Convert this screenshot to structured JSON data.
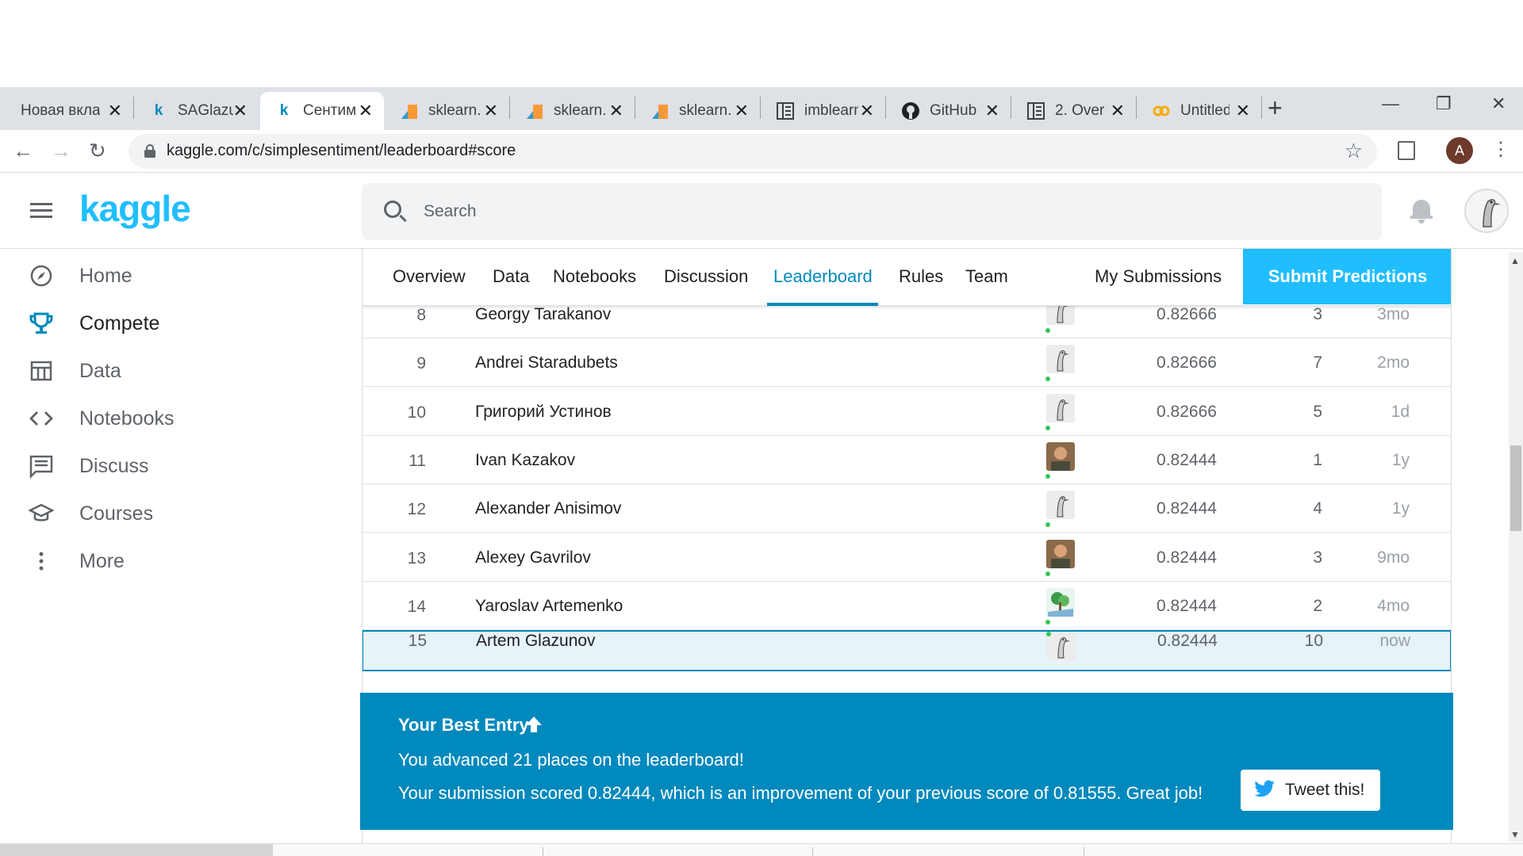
{
  "browser": {
    "tabs": [
      {
        "label": "Новая вкладка",
        "icon": "blank-icon"
      },
      {
        "label": "SAGlazunov",
        "icon": "kaggle-icon"
      },
      {
        "label": "Сентимент",
        "icon": "kaggle-icon",
        "active": true
      },
      {
        "label": "sklearn.",
        "icon": "sklearn-icon"
      },
      {
        "label": "sklearn.",
        "icon": "sklearn-icon"
      },
      {
        "label": "sklearn.",
        "icon": "sklearn-icon"
      },
      {
        "label": "imblearn",
        "icon": "docs-icon"
      },
      {
        "label": "GitHub",
        "icon": "github-icon"
      },
      {
        "label": "2. Over",
        "icon": "docs-icon"
      },
      {
        "label": "Untitled",
        "icon": "colab-icon"
      }
    ],
    "new_tab": "+",
    "window_controls": {
      "minimize": "—",
      "restore": "❐",
      "close": "✕"
    },
    "url": "kaggle.com/c/simplesentiment/leaderboard#score",
    "profile_initial": "A"
  },
  "header": {
    "logo": "kaggle",
    "search_placeholder": "Search"
  },
  "sidebar": {
    "items": [
      {
        "label": "Home",
        "icon": "compass-icon"
      },
      {
        "label": "Compete",
        "icon": "trophy-icon",
        "active": true
      },
      {
        "label": "Data",
        "icon": "table-icon"
      },
      {
        "label": "Notebooks",
        "icon": "code-icon"
      },
      {
        "label": "Discuss",
        "icon": "comment-icon"
      },
      {
        "label": "Courses",
        "icon": "graduation-cap-icon"
      },
      {
        "label": "More",
        "icon": "more-vert-icon"
      }
    ]
  },
  "competition": {
    "tabs": [
      "Overview",
      "Data",
      "Notebooks",
      "Discussion",
      "Leaderboard",
      "Rules",
      "Team",
      "My Submissions"
    ],
    "active_tab": "Leaderboard",
    "submit_label": "Submit Predictions"
  },
  "leaderboard": {
    "rows": [
      {
        "rank": "8",
        "name": "Georgy Tarakanov",
        "score": "0.82666",
        "entries": "3",
        "last": "3mo",
        "avatar": "goose"
      },
      {
        "rank": "9",
        "name": "Andrei Staradubets",
        "score": "0.82666",
        "entries": "7",
        "last": "2mo",
        "avatar": "goose"
      },
      {
        "rank": "10",
        "name": "Григорий Устинов",
        "score": "0.82666",
        "entries": "5",
        "last": "1d",
        "avatar": "goose"
      },
      {
        "rank": "11",
        "name": "Ivan Kazakov",
        "score": "0.82444",
        "entries": "1",
        "last": "1y",
        "avatar": "photo"
      },
      {
        "rank": "12",
        "name": "Alexander Anisimov",
        "score": "0.82444",
        "entries": "4",
        "last": "1y",
        "avatar": "goose"
      },
      {
        "rank": "13",
        "name": "Alexey Gavrilov",
        "score": "0.82444",
        "entries": "3",
        "last": "9mo",
        "avatar": "photo"
      },
      {
        "rank": "14",
        "name": "Yaroslav Artemenko",
        "score": "0.82444",
        "entries": "2",
        "last": "4mo",
        "avatar": "tree"
      },
      {
        "rank": "15",
        "name": "Artem Glazunov",
        "score": "0.82444",
        "entries": "10",
        "last": "now",
        "avatar": "goose",
        "highlight": true
      }
    ]
  },
  "banner": {
    "title": "Your Best Entry",
    "line1": "You advanced 21 places on the leaderboard!",
    "line2": "Your submission scored 0.82444, which is an improvement of your previous score of 0.81555. Great job!",
    "tweet_label": "Tweet this!"
  },
  "colors": {
    "kaggle_blue": "#20beff",
    "accent": "#008abc",
    "banner_bg": "#0089bd",
    "highlight_row": "#e6f3f9"
  }
}
